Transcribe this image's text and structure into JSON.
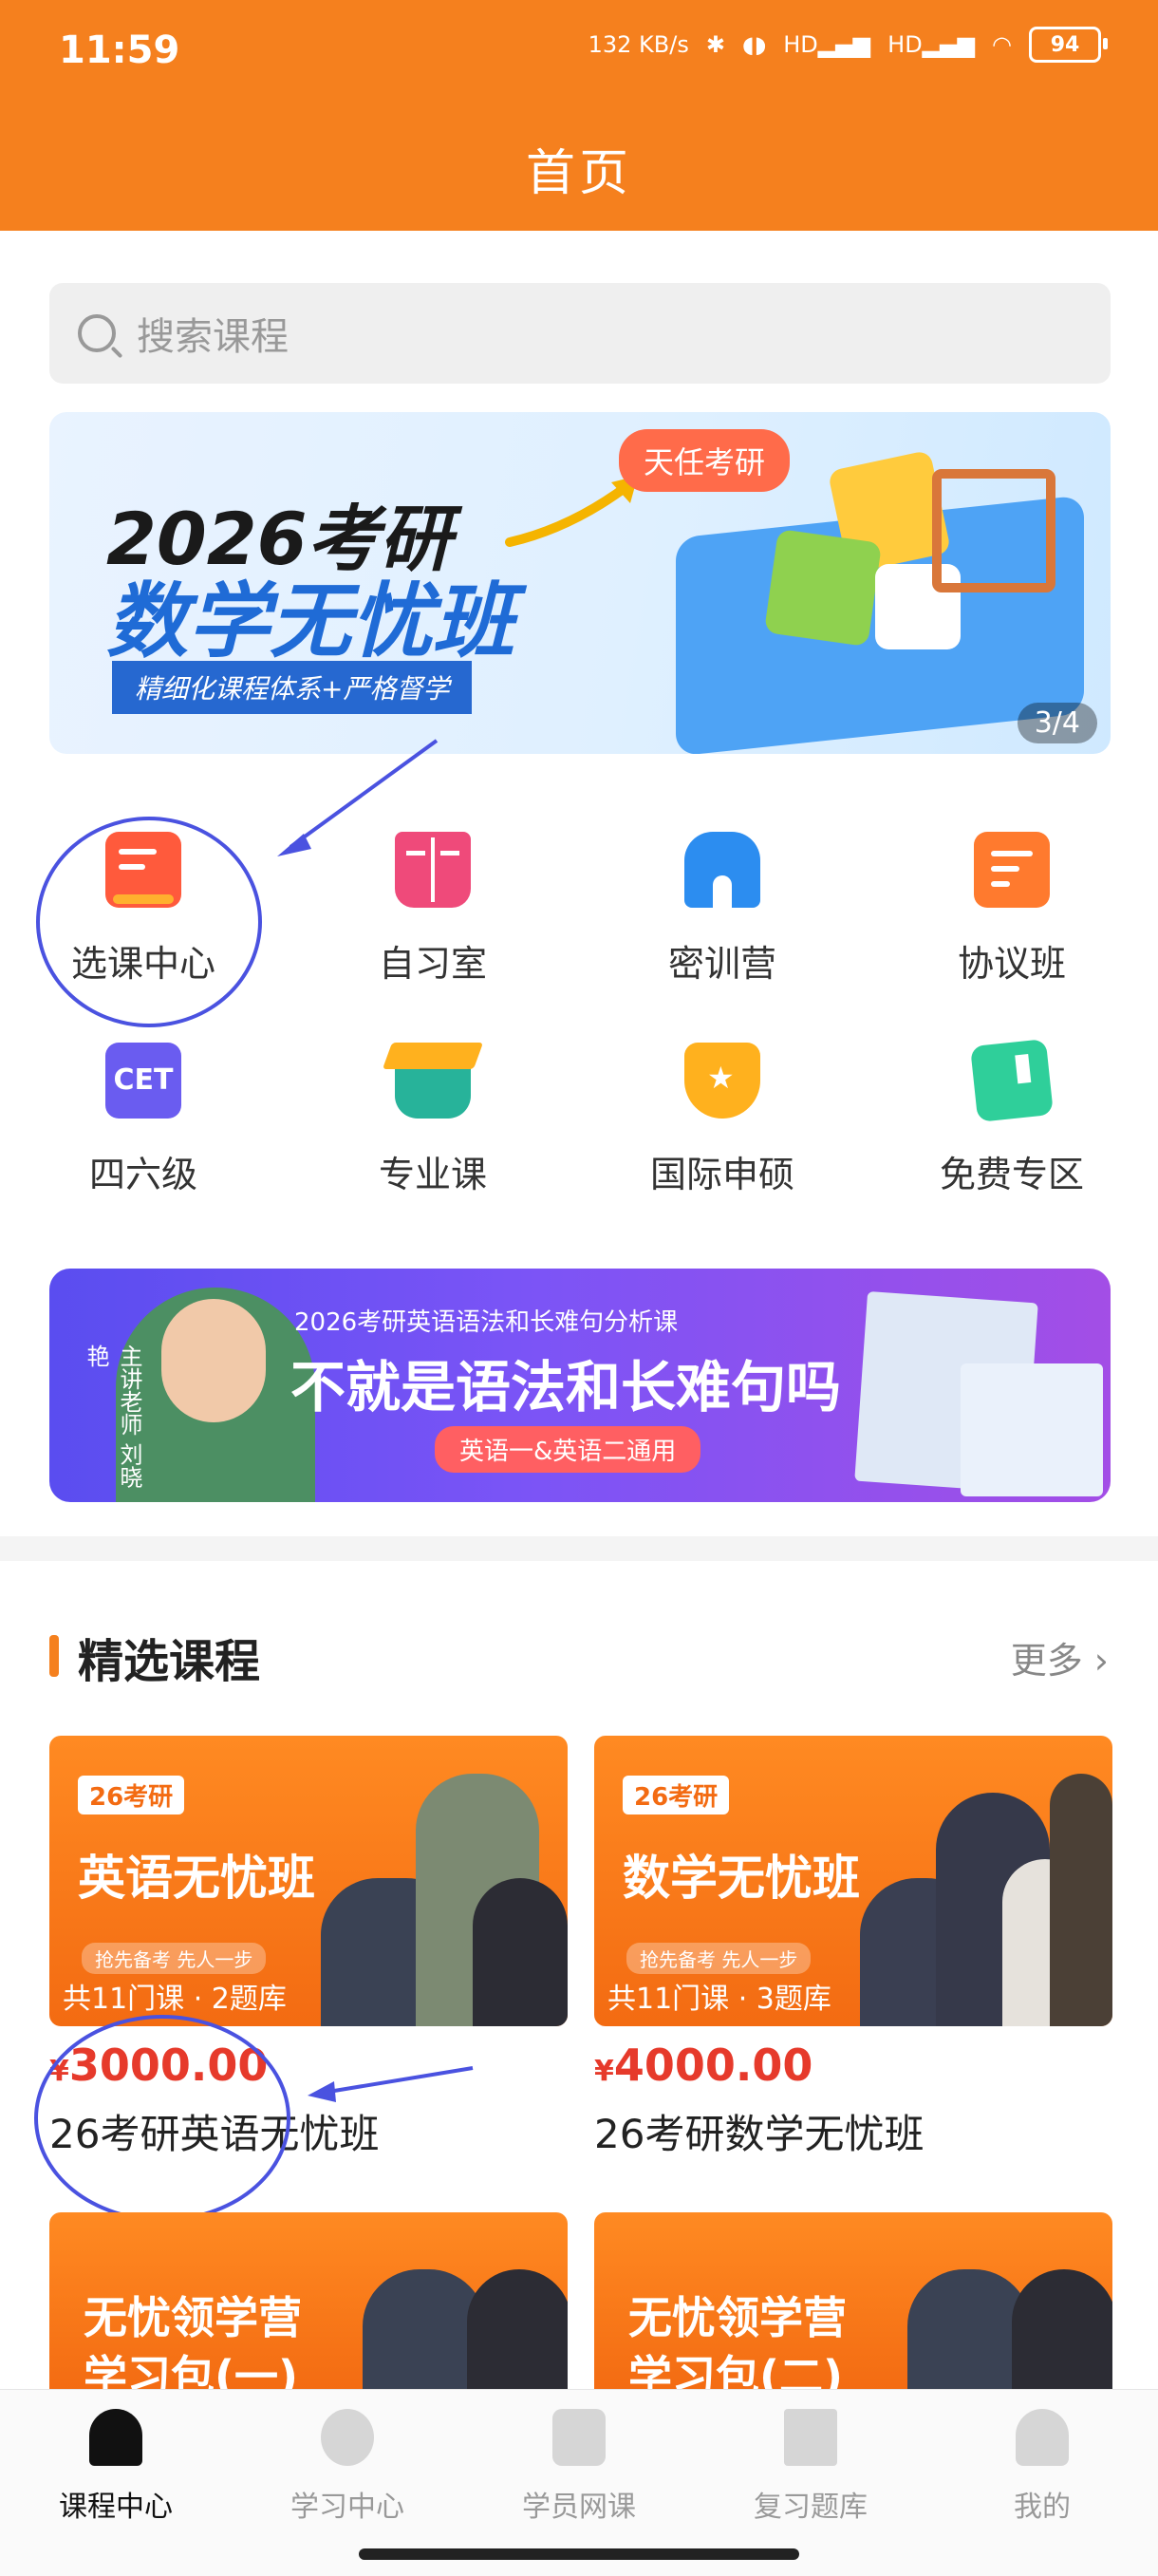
{
  "status_bar": {
    "time": "11:59",
    "net_speed": "132 KB/s",
    "signal1": "HD",
    "signal2": "HD",
    "battery": "94"
  },
  "header": {
    "title": "首页"
  },
  "search": {
    "placeholder": "搜索课程"
  },
  "banner_main": {
    "year_text": "2026考研",
    "headline": "数学无忧班",
    "subline": "精细化课程体系+严格督学",
    "tag": "天任考研",
    "page_indicator": "3/4"
  },
  "categories": [
    {
      "label": "选课中心",
      "icon": "course-select-icon",
      "color": "#ff5a3c"
    },
    {
      "label": "自习室",
      "icon": "book-icon",
      "color": "#ef4a7a"
    },
    {
      "label": "密训营",
      "icon": "castle-icon",
      "color": "#2c8df0"
    },
    {
      "label": "协议班",
      "icon": "document-icon",
      "color": "#ff7a2e"
    },
    {
      "label": "四六级",
      "icon": "cet-icon",
      "color": "#6a5cf0"
    },
    {
      "label": "专业课",
      "icon": "graduation-cap-icon",
      "color": "#27b39a"
    },
    {
      "label": "国际申硕",
      "icon": "trophy-icon",
      "color": "#ffb11e"
    },
    {
      "label": "免费专区",
      "icon": "free-card-icon",
      "color": "#2fcf9a"
    }
  ],
  "cet_text": "CET",
  "banner_english": {
    "subtitle": "2026考研英语语法和长难句分析课",
    "headline": "不就是语法和长难句吗",
    "pill": "英语一&英语二通用",
    "teacher": "主讲老师 刘晓艳"
  },
  "featured": {
    "title": "精选课程",
    "more": "更多 ›"
  },
  "courses": [
    {
      "tag": "26考研",
      "name": "英语无忧班",
      "slogan": "抢先备考 先人一步",
      "count": "共11门课 · 2题库",
      "currency": "¥",
      "price": "3000.00",
      "title": "26考研英语无忧班"
    },
    {
      "tag": "26考研",
      "name": "数学无忧班",
      "slogan": "抢先备考 先人一步",
      "count": "共11门课 · 3题库",
      "currency": "¥",
      "price": "4000.00",
      "title": "26考研数学无忧班"
    }
  ],
  "courses_row2": [
    {
      "name_line1": "无忧领学营",
      "name_line2": "学习包(一)"
    },
    {
      "name_line1": "无忧领学营",
      "name_line2": "学习包(二)"
    }
  ],
  "bottom_nav": [
    {
      "label": "课程中心",
      "icon": "home-icon",
      "active": true
    },
    {
      "label": "学习中心",
      "icon": "compass-icon",
      "active": false
    },
    {
      "label": "学员网课",
      "icon": "play-icon",
      "active": false
    },
    {
      "label": "复习题库",
      "icon": "question-bank-icon",
      "active": false
    },
    {
      "label": "我的",
      "icon": "profile-icon",
      "active": false
    }
  ],
  "colors": {
    "brand": "#f5801e",
    "price": "#e63a2b",
    "annotation": "#4a52e0"
  }
}
